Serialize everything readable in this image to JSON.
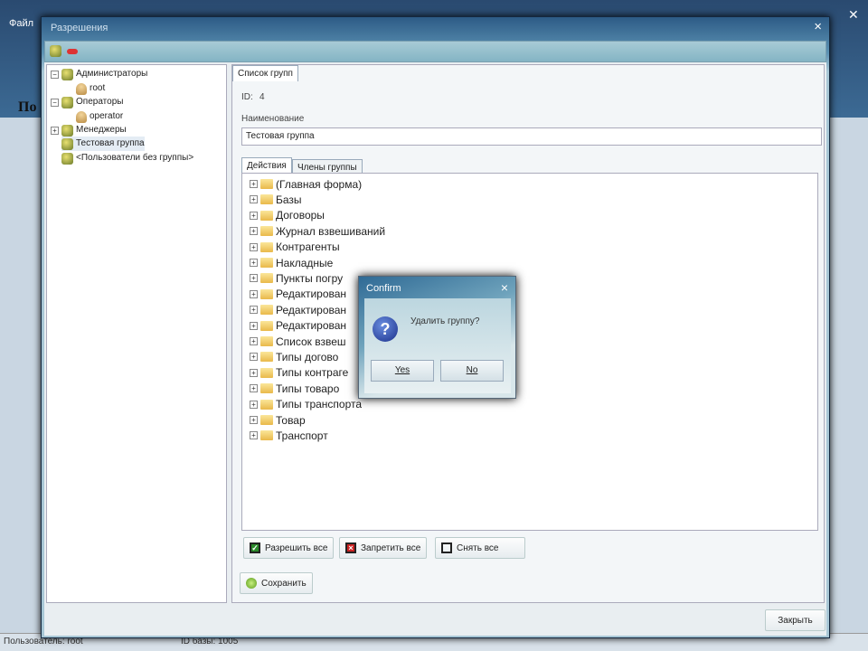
{
  "app": {
    "menu": "Файл",
    "logo_text": "По"
  },
  "status": {
    "user": "Пользователь: root",
    "db": "ID базы: 1005"
  },
  "dialog": {
    "title": "Разрешения",
    "close": "×",
    "groups": [
      {
        "label": "Администраторы",
        "expanded": "−",
        "users": [
          "root"
        ]
      },
      {
        "label": "Операторы",
        "expanded": "−",
        "users": [
          "operator"
        ]
      },
      {
        "label": "Менеджеры",
        "expanded": "+",
        "users": []
      },
      {
        "label": "Тестовая группа",
        "users": []
      },
      {
        "label": "<Пользователи без группы>",
        "users": []
      }
    ],
    "tab_list": "Список групп",
    "id_label": "ID:",
    "id_value": "4",
    "name_label": "Наименование",
    "name_value": "Тестовая группа",
    "tabs": [
      "Действия",
      "Члены группы"
    ],
    "actions": [
      "(Главная форма)",
      "Базы",
      "Договоры",
      "Журнал взвешиваний",
      "Контрагенты",
      "Накладные",
      "Пункты погру",
      "Редактирован",
      "Редактирован",
      "Редактирован",
      "Список взвеш",
      "Типы догово",
      "Типы контраге",
      "Типы товаро",
      "Типы транспорта",
      "Товар",
      "Транспорт"
    ],
    "allow_all": "Разрешить все",
    "deny_all": "Запретить все",
    "clear_all": "Снять все",
    "save": "Сохранить",
    "close_btn": "Закрыть"
  },
  "confirm": {
    "title": "Confirm",
    "message": "Удалить группу?",
    "yes": "Yes",
    "no": "No",
    "close": "×"
  }
}
